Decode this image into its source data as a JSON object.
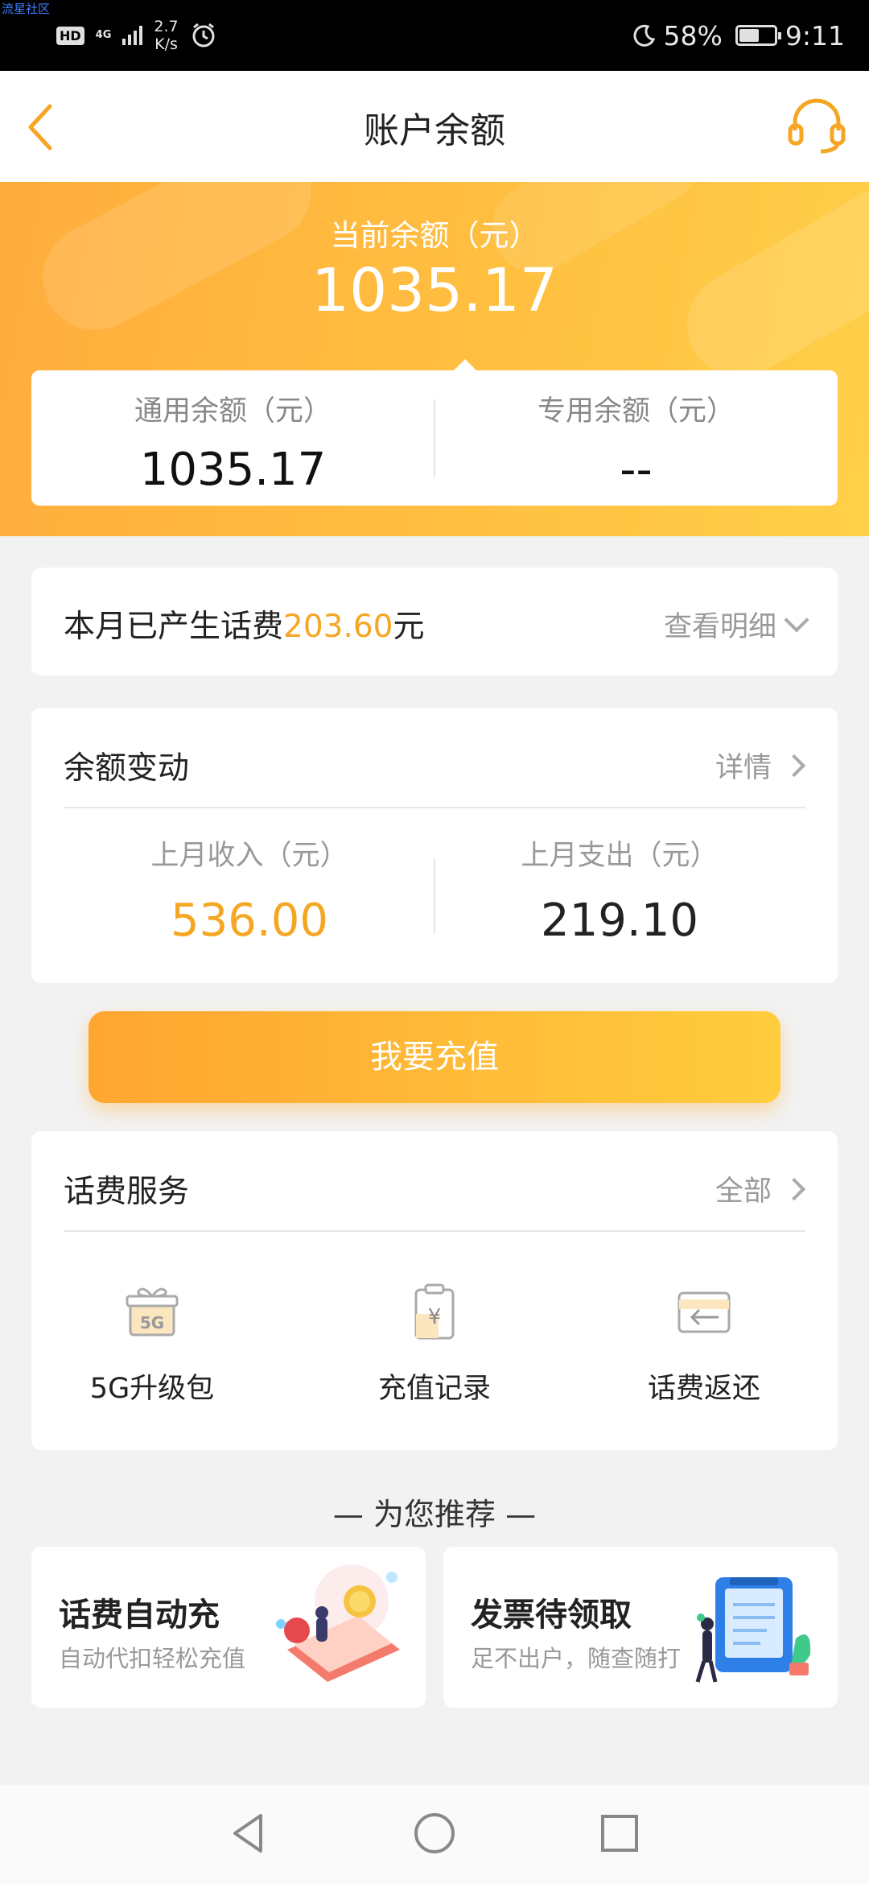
{
  "status_bar": {
    "watermark": "流星社区",
    "hd": "HD",
    "network": "4G",
    "speed_value": "2.7",
    "speed_unit": "K/s",
    "battery": "58%",
    "battery_level": 0.58,
    "time": "9:11"
  },
  "header": {
    "title": "账户余额"
  },
  "hero": {
    "label": "当前余额（元）",
    "value": "1035.17",
    "general_label": "通用余额（元）",
    "general_value": "1035.17",
    "special_label": "专用余额（元）",
    "special_value": "--"
  },
  "bill": {
    "prefix": "本月已产生话费",
    "amount": "203.60",
    "suffix": "元",
    "link": "查看明细"
  },
  "balance_change": {
    "title": "余额变动",
    "link": "详情",
    "income_label": "上月收入（元）",
    "income_value": "536.00",
    "expense_label": "上月支出（元）",
    "expense_value": "219.10"
  },
  "recharge_button": "我要充值",
  "services": {
    "title": "话费服务",
    "link": "全部",
    "items": [
      {
        "label": "5G升级包",
        "icon": "gift-5g-icon",
        "icon_text": "5G"
      },
      {
        "label": "充值记录",
        "icon": "recharge-record-icon",
        "icon_text": "¥"
      },
      {
        "label": "话费返还",
        "icon": "refund-icon"
      }
    ]
  },
  "recommend": {
    "title": "— 为您推荐 —",
    "cards": [
      {
        "title": "话费自动充",
        "subtitle": "自动代扣轻松充值"
      },
      {
        "title": "发票待领取",
        "subtitle": "足不出户，随查随打"
      }
    ]
  },
  "colors": {
    "accent": "#f5a623",
    "hero_start": "#ffad3d",
    "hero_end": "#ffd04a"
  }
}
